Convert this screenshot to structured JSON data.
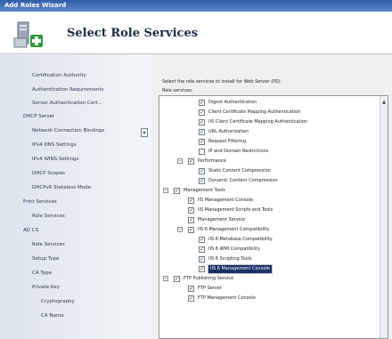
{
  "window": {
    "title": "Add Roles Wizard"
  },
  "header": {
    "title": "Select Role Services"
  },
  "nav": {
    "items": [
      {
        "label": "Certification Authority",
        "level": 1
      },
      {
        "label": "Authentication Requirements",
        "level": 1
      },
      {
        "label": "Server Authentication Cert...",
        "level": 1
      },
      {
        "label": "DHCP Server",
        "level": 0
      },
      {
        "label": "Network Connection Bindings",
        "level": 1
      },
      {
        "label": "IPv4 DNS Settings",
        "level": 1
      },
      {
        "label": "IPv4 WINS Settings",
        "level": 1
      },
      {
        "label": "DHCP Scopes",
        "level": 1
      },
      {
        "label": "DHCPv6 Stateless Mode",
        "level": 1
      },
      {
        "label": "Print Services",
        "level": 0
      },
      {
        "label": "Role Services",
        "level": 1
      },
      {
        "label": "AD CS",
        "level": 0
      },
      {
        "label": "Role Services",
        "level": 1
      },
      {
        "label": "Setup Type",
        "level": 1
      },
      {
        "label": "CA Type",
        "level": 1
      },
      {
        "label": "Private Key",
        "level": 1
      },
      {
        "label": "Cryptography",
        "level": 2
      },
      {
        "label": "CA Name",
        "level": 2
      }
    ]
  },
  "main": {
    "instruction": "Select the role services to install for Web Server (IIS):",
    "list_label": "Role services:"
  },
  "tree": [
    {
      "label": "Digest Authentication",
      "checked": true,
      "level": 3
    },
    {
      "label": "Client Certificate Mapping Authentication",
      "checked": true,
      "level": 3
    },
    {
      "label": "IIS Client Certificate Mapping Authentication",
      "checked": true,
      "level": 3
    },
    {
      "label": "URL Authorization",
      "checked": true,
      "level": 3
    },
    {
      "label": "Request Filtering",
      "checked": true,
      "level": 3
    },
    {
      "label": "IP and Domain Restrictions",
      "checked": false,
      "level": 3
    },
    {
      "label": "Performance",
      "checked": true,
      "level": 2,
      "toggle": "-"
    },
    {
      "label": "Static Content Compression",
      "checked": true,
      "level": 3
    },
    {
      "label": "Dynamic Content Compression",
      "checked": true,
      "level": 3
    },
    {
      "label": "Management Tools",
      "checked": true,
      "level": 1,
      "toggle": "-"
    },
    {
      "label": "IIS Management Console",
      "checked": true,
      "level": 2
    },
    {
      "label": "IIS Management Scripts and Tools",
      "checked": true,
      "level": 2
    },
    {
      "label": "Management Service",
      "checked": true,
      "level": 2
    },
    {
      "label": "IIS 6 Management Compatibility",
      "checked": true,
      "level": 2,
      "toggle": "-"
    },
    {
      "label": "IIS 6 Metabase Compatibility",
      "checked": true,
      "level": 3
    },
    {
      "label": "IIS 6 WMI Compatibility",
      "checked": true,
      "level": 3
    },
    {
      "label": "IIS 6 Scripting Tools",
      "checked": true,
      "level": 3
    },
    {
      "label": "IIS 6 Management Console",
      "checked": true,
      "level": 3,
      "selected": true
    },
    {
      "label": "FTP Publishing Service",
      "checked": true,
      "level": 1,
      "toggle": "-"
    },
    {
      "label": "FTP Server",
      "checked": true,
      "level": 2
    },
    {
      "label": "FTP Management Console",
      "checked": true,
      "level": 2
    }
  ],
  "icons": {
    "wizard": "server-roles-icon",
    "nav_scroll": "scroll-up-icon",
    "tree_scroll": "scroll-up-icon"
  },
  "colors": {
    "titlebar": "#2e5fa8",
    "selection": "#1b2f6b"
  }
}
